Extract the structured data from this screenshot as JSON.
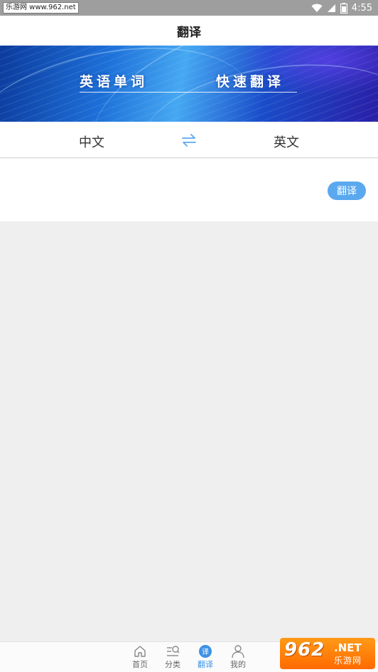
{
  "status_bar": {
    "watermark_text": "乐游网 www.962.net",
    "battery": "2",
    "time": "4:55"
  },
  "header": {
    "title": "翻译"
  },
  "banner": {
    "left_phrase": "英语单词",
    "right_phrase": "快速翻译"
  },
  "languages": {
    "source": "中文",
    "target": "英文",
    "swap_icon": "swap-arrows-icon"
  },
  "translate_button": {
    "label": "翻译"
  },
  "bottom_nav": {
    "items": [
      {
        "label": "首页",
        "icon": "home-icon"
      },
      {
        "label": "分类",
        "icon": "category-search-icon"
      },
      {
        "label": "翻译",
        "icon": "translate-icon",
        "active": true,
        "badge": "译"
      },
      {
        "label": "我的",
        "icon": "user-icon"
      }
    ]
  },
  "watermark_logo": {
    "number": "962",
    "domain": ".NET",
    "brand": "乐游网"
  },
  "colors": {
    "accent": "#3d93e6",
    "button": "#5aa9ef",
    "page_bg": "#efefef"
  }
}
